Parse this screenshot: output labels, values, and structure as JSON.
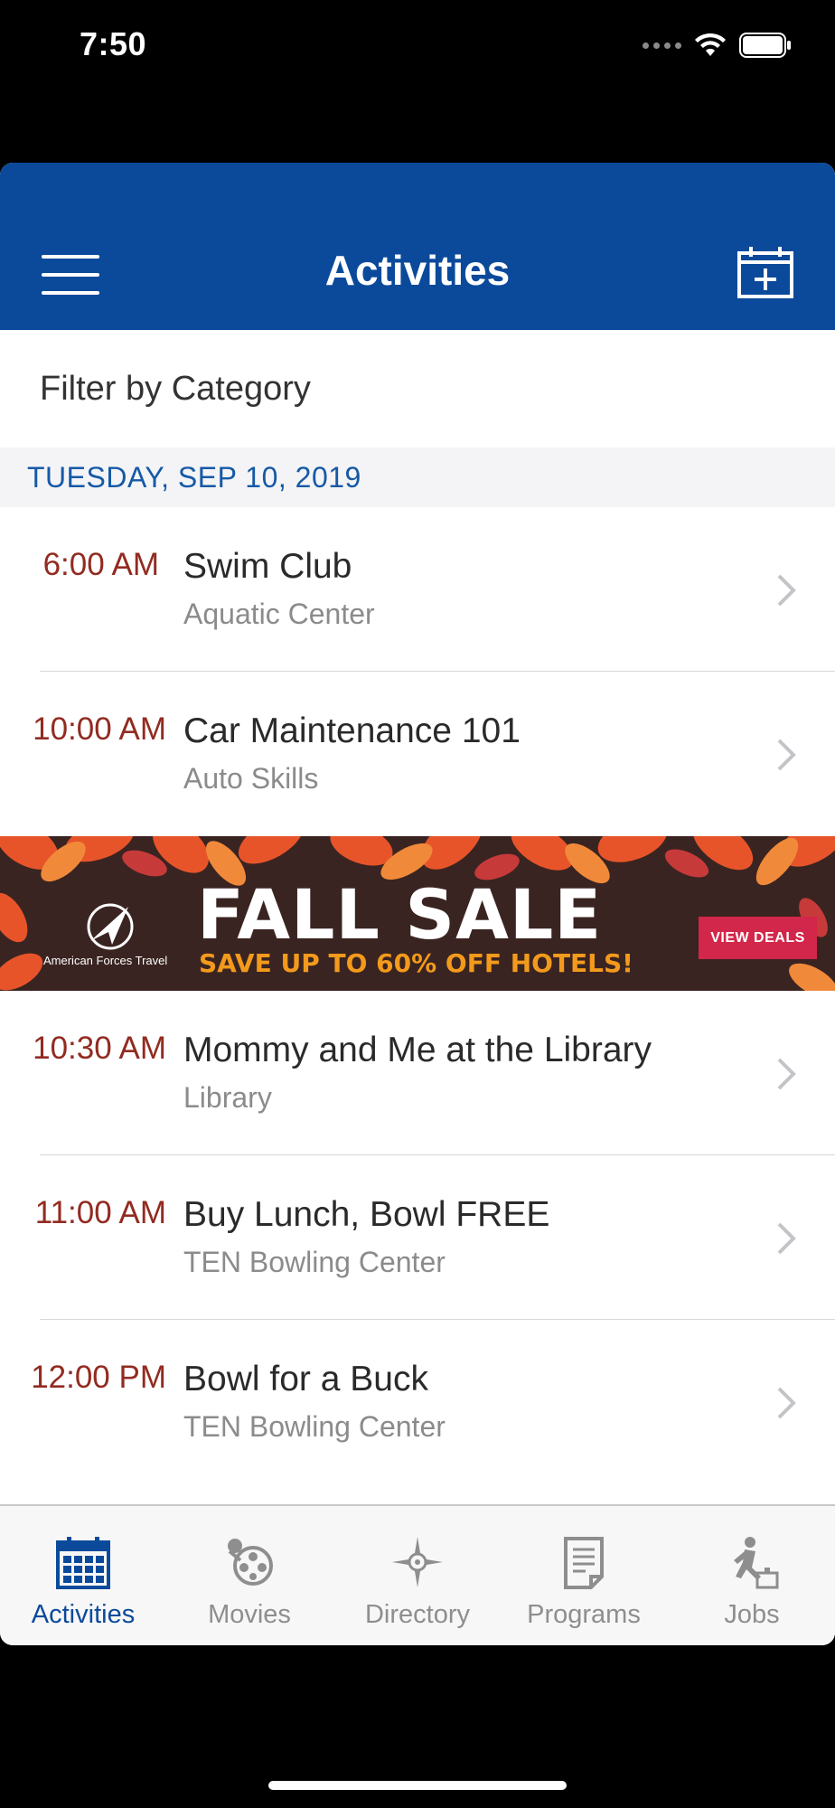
{
  "status": {
    "time": "7:50"
  },
  "header": {
    "title": "Activities"
  },
  "filter": {
    "label": "Filter by Category"
  },
  "date": "TUESDAY, SEP 10, 2019",
  "events": [
    {
      "time": "6:00 AM",
      "title": "Swim Club",
      "location": "Aquatic Center"
    },
    {
      "time": "10:00 AM",
      "title": "Car Maintenance 101",
      "location": "Auto Skills"
    },
    {
      "time": "10:30 AM",
      "title": "Mommy and Me at the Library",
      "location": "Library"
    },
    {
      "time": "11:00 AM",
      "title": "Buy Lunch, Bowl FREE",
      "location": "TEN Bowling Center"
    },
    {
      "time": "12:00 PM",
      "title": "Bowl for a Buck",
      "location": "TEN Bowling Center"
    }
  ],
  "ad": {
    "headline": "FALL SALE",
    "subline": "SAVE UP TO 60% OFF HOTELS!",
    "brand": "American Forces Travel",
    "cta": "VIEW DEALS"
  },
  "tabs": [
    {
      "label": "Activities",
      "icon": "calendar-icon",
      "active": true
    },
    {
      "label": "Movies",
      "icon": "film-reel-icon",
      "active": false
    },
    {
      "label": "Directory",
      "icon": "compass-icon",
      "active": false
    },
    {
      "label": "Programs",
      "icon": "document-icon",
      "active": false
    },
    {
      "label": "Jobs",
      "icon": "worker-icon",
      "active": false
    }
  ],
  "colors": {
    "brand_blue": "#0b4a9b",
    "time_red": "#922b21",
    "ad_cta": "#d2264a",
    "ad_orange": "#f39a1c"
  }
}
